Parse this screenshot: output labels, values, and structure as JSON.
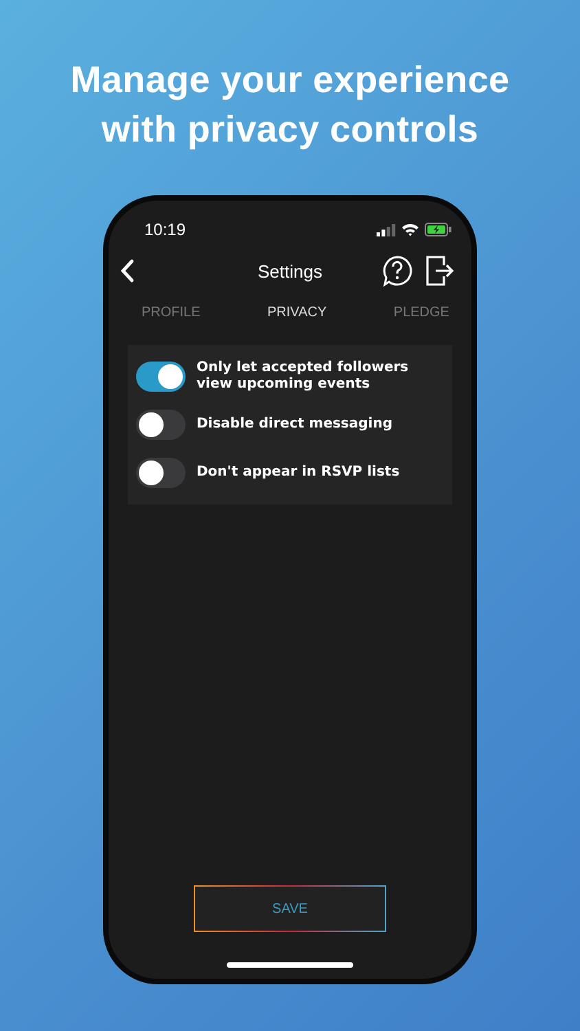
{
  "headline": [
    "Manage your experience",
    "with privacy controls"
  ],
  "status_bar": {
    "time": "10:19"
  },
  "nav": {
    "title": "Settings"
  },
  "tabs": [
    {
      "label": "PROFILE",
      "selected": false
    },
    {
      "label": "PRIVACY",
      "selected": true
    },
    {
      "label": "PLEDGE",
      "selected": false
    }
  ],
  "toggles": [
    {
      "label": "Only let accepted followers view upcoming events",
      "on": true
    },
    {
      "label": "Disable direct messaging",
      "on": false
    },
    {
      "label": "Don't appear in RSVP lists",
      "on": false
    }
  ],
  "save_button": "SAVE"
}
